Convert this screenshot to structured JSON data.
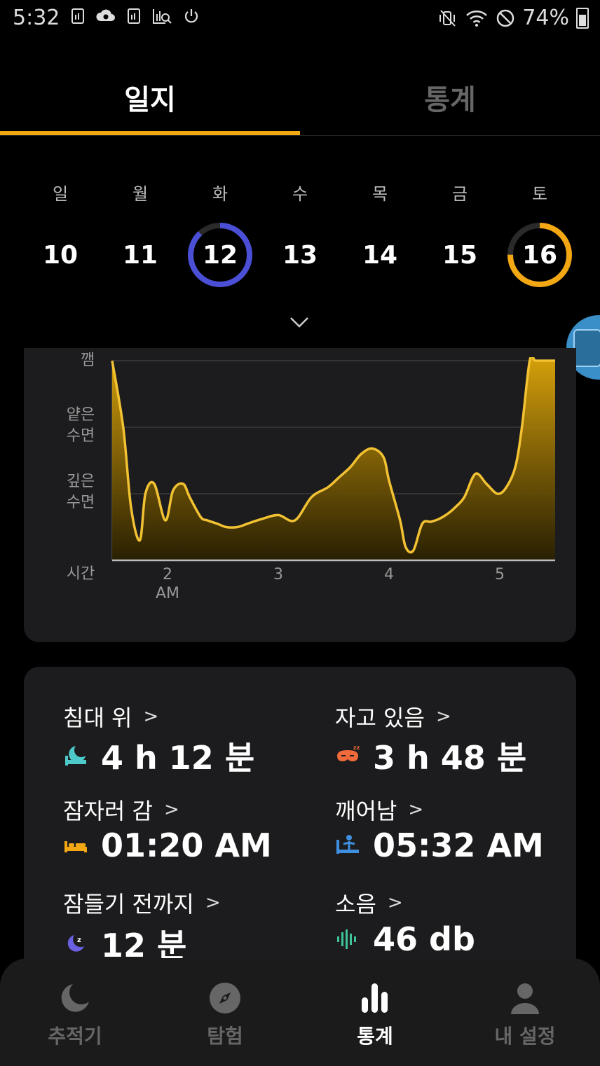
{
  "status_bar": {
    "time": "5:32",
    "battery": "74%",
    "icons": [
      "sim-icon",
      "cloud-sync-icon",
      "sim-icon",
      "chart-search-icon",
      "power-icon"
    ],
    "right_icons": [
      "mute-vibrate-icon",
      "wifi-icon",
      "blocked-icon",
      "battery-icon"
    ]
  },
  "tabs": [
    {
      "label": "일지",
      "active": true
    },
    {
      "label": "통계",
      "active": false
    }
  ],
  "week": {
    "days": [
      {
        "label": "일",
        "date": "10",
        "ring": null
      },
      {
        "label": "월",
        "date": "11",
        "ring": null
      },
      {
        "label": "화",
        "date": "12",
        "ring": {
          "color": "#4a4fd6",
          "progress": 0.88
        }
      },
      {
        "label": "수",
        "date": "13",
        "ring": null
      },
      {
        "label": "목",
        "date": "14",
        "ring": null
      },
      {
        "label": "금",
        "date": "15",
        "ring": null
      },
      {
        "label": "토",
        "date": "16",
        "ring": {
          "color": "#f2a713",
          "progress": 0.75
        }
      }
    ]
  },
  "chart_data": {
    "type": "area",
    "y_levels": [
      "깸",
      "얕은\n수면",
      "깊은\n수면",
      "시간"
    ],
    "x_ticks": [
      {
        "value": 2,
        "label": "2",
        "sublabel": "AM"
      },
      {
        "value": 3,
        "label": "3",
        "sublabel": ""
      },
      {
        "value": 4,
        "label": "4",
        "sublabel": ""
      },
      {
        "value": 5,
        "label": "5",
        "sublabel": ""
      }
    ],
    "x_range": [
      1.5,
      5.5
    ],
    "y_range": [
      0,
      3
    ],
    "series": [
      {
        "color": "#f2c233",
        "x": [
          1.5,
          1.6,
          1.67,
          1.75,
          1.8,
          1.88,
          1.98,
          2.05,
          2.14,
          2.2,
          2.3,
          2.36,
          2.45,
          2.53,
          2.63,
          2.72,
          2.85,
          3.0,
          3.15,
          3.3,
          3.45,
          3.55,
          3.65,
          3.75,
          3.85,
          3.95,
          4.0,
          4.1,
          4.15,
          4.22,
          4.3,
          4.38,
          4.45,
          4.53,
          4.6,
          4.68,
          4.78,
          4.88,
          4.98,
          5.06,
          5.14,
          5.2,
          5.27,
          5.32,
          5.37,
          5.43,
          5.5
        ],
        "values": [
          3.0,
          2.0,
          0.8,
          0.3,
          1.0,
          1.15,
          0.6,
          1.05,
          1.15,
          0.95,
          0.65,
          0.6,
          0.55,
          0.5,
          0.5,
          0.55,
          0.62,
          0.68,
          0.6,
          0.95,
          1.1,
          1.25,
          1.4,
          1.6,
          1.68,
          1.55,
          1.2,
          0.6,
          0.2,
          0.15,
          0.55,
          0.58,
          0.62,
          0.7,
          0.8,
          0.95,
          1.3,
          1.15,
          1.0,
          1.1,
          1.4,
          2.0,
          3.0,
          3.0,
          3.0,
          3.0,
          3.0
        ]
      }
    ]
  },
  "stats": {
    "in_bed": {
      "label": "침대 위",
      "value": "4 h 12 분",
      "icon": "moon-bed-icon",
      "icon_color": "#4ec9c9"
    },
    "asleep": {
      "label": "자고 있음",
      "value": "3 h 48 분",
      "icon": "sleep-mask-icon",
      "icon_color": "#ef6a3a"
    },
    "went_to_bed": {
      "label": "잠자러 감",
      "value": "01:20 AM",
      "icon": "bed-icon",
      "icon_color": "#f2a713"
    },
    "woke_up": {
      "label": "깨어남",
      "value": "05:32 AM",
      "icon": "wake-up-icon",
      "icon_color": "#3f8fe0"
    },
    "fall_asleep": {
      "label": "잠들기 전까지",
      "value": "12 분",
      "icon": "moon-z-icon",
      "icon_color": "#6a60e0"
    },
    "noise": {
      "label": "소음",
      "value": "46 db",
      "icon": "sound-wave-icon",
      "icon_color": "#3fc49a"
    }
  },
  "bottom_nav": [
    {
      "label": "추적기",
      "icon": "moon-icon",
      "active": false
    },
    {
      "label": "탐험",
      "icon": "compass-icon",
      "active": false
    },
    {
      "label": "통계",
      "icon": "bar-chart-icon",
      "active": true
    },
    {
      "label": "내 설정",
      "icon": "profile-icon",
      "active": false
    }
  ]
}
